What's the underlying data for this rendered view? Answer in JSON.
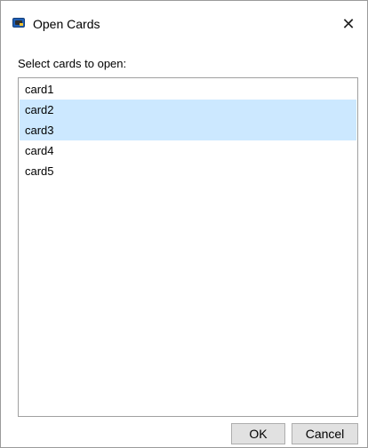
{
  "window": {
    "title": "Open Cards",
    "icon": "app-card-icon",
    "close_glyph": "✕"
  },
  "main": {
    "prompt": "Select cards to open:",
    "items": [
      {
        "label": "card1",
        "selected": false
      },
      {
        "label": "card2",
        "selected": true
      },
      {
        "label": "card3",
        "selected": true
      },
      {
        "label": "card4",
        "selected": false
      },
      {
        "label": "card5",
        "selected": false
      }
    ]
  },
  "footer": {
    "ok_label": "OK",
    "cancel_label": "Cancel"
  },
  "colors": {
    "selection": "#cce8ff"
  }
}
